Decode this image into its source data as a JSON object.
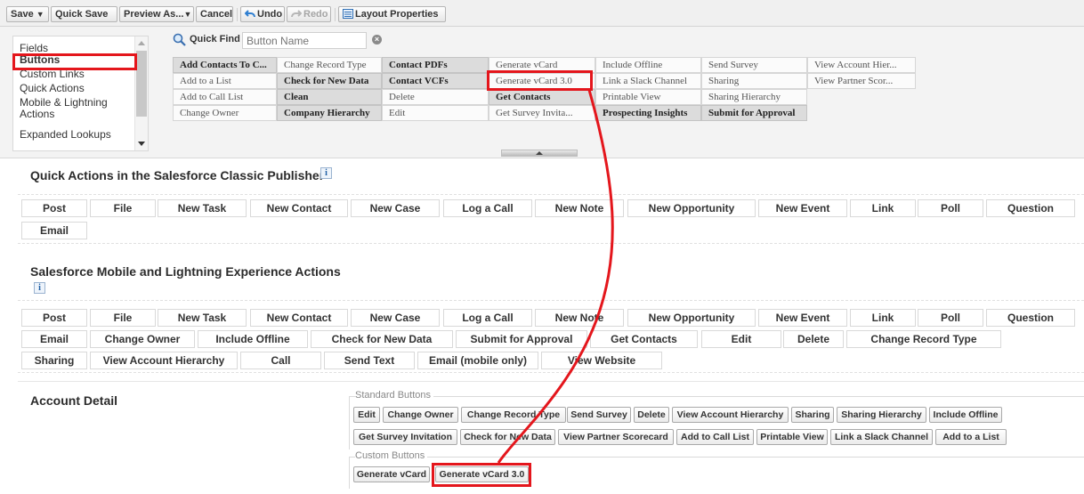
{
  "toolbar": {
    "save": "Save",
    "quick_save": "Quick Save",
    "preview_as": "Preview As...",
    "cancel": "Cancel",
    "undo": "Undo",
    "redo": "Redo",
    "layout_properties": "Layout Properties"
  },
  "palette": {
    "categories": [
      "Fields",
      "Buttons",
      "Custom Links",
      "Quick Actions",
      "Mobile & Lightning Actions",
      "Expanded Lookups"
    ],
    "selected_category": "Buttons",
    "quick_find_label": "Quick Find",
    "quick_find_placeholder": "Button Name",
    "columns": [
      [
        "Add Contacts To C...",
        "Add to a List",
        "Add to Call List",
        "Change Owner"
      ],
      [
        "Change Record Type",
        "Check for New Data",
        "Clean",
        "Company Hierarchy"
      ],
      [
        "Contact PDFs",
        "Contact VCFs",
        "Delete",
        "Edit"
      ],
      [
        "Generate vCard",
        "Generate vCard 3.0",
        "Get Contacts",
        "Get Survey Invita..."
      ],
      [
        "Include Offline",
        "Link a Slack Channel",
        "Printable View",
        "Prospecting Insights"
      ],
      [
        "Send Survey",
        "Sharing",
        "Sharing Hierarchy",
        "Submit for Approval"
      ],
      [
        "View Account Hier...",
        "View Partner Scor..."
      ]
    ]
  },
  "classic_publisher": {
    "title": "Quick Actions in the Salesforce Classic Publisher",
    "actions": [
      "Post",
      "File",
      "New Task",
      "New Contact",
      "New Case",
      "Log a Call",
      "New Note",
      "New Opportunity",
      "New Event",
      "Link",
      "Poll",
      "Question",
      "Email"
    ]
  },
  "mobile_actions": {
    "title": "Salesforce Mobile and Lightning Experience Actions",
    "actions": [
      "Post",
      "File",
      "New Task",
      "New Contact",
      "New Case",
      "Log a Call",
      "New Note",
      "New Opportunity",
      "New Event",
      "Link",
      "Poll",
      "Question",
      "Email",
      "Change Owner",
      "Include Offline",
      "Check for New Data",
      "Submit for Approval",
      "Get Contacts",
      "Edit",
      "Delete",
      "Change Record Type",
      "Sharing",
      "View Account Hierarchy",
      "Call",
      "Send Text",
      "Email (mobile only)",
      "View Website"
    ]
  },
  "account_detail": {
    "title": "Account Detail",
    "standard_label": "Standard Buttons",
    "standard_buttons": [
      "Edit",
      "Change Owner",
      "Change Record Type",
      "Send Survey",
      "Delete",
      "View Account Hierarchy",
      "Sharing",
      "Sharing Hierarchy",
      "Include Offline",
      "Get Survey Invitation",
      "Check for New Data",
      "View Partner Scorecard",
      "Add to Call List",
      "Printable View",
      "Link a Slack Channel",
      "Add to a List"
    ],
    "custom_label": "Custom Buttons",
    "custom_buttons": [
      "Generate vCard",
      "Generate vCard 3.0"
    ]
  },
  "colors": {
    "highlight": "#e4161c",
    "used_item": "#dcdcdc"
  }
}
